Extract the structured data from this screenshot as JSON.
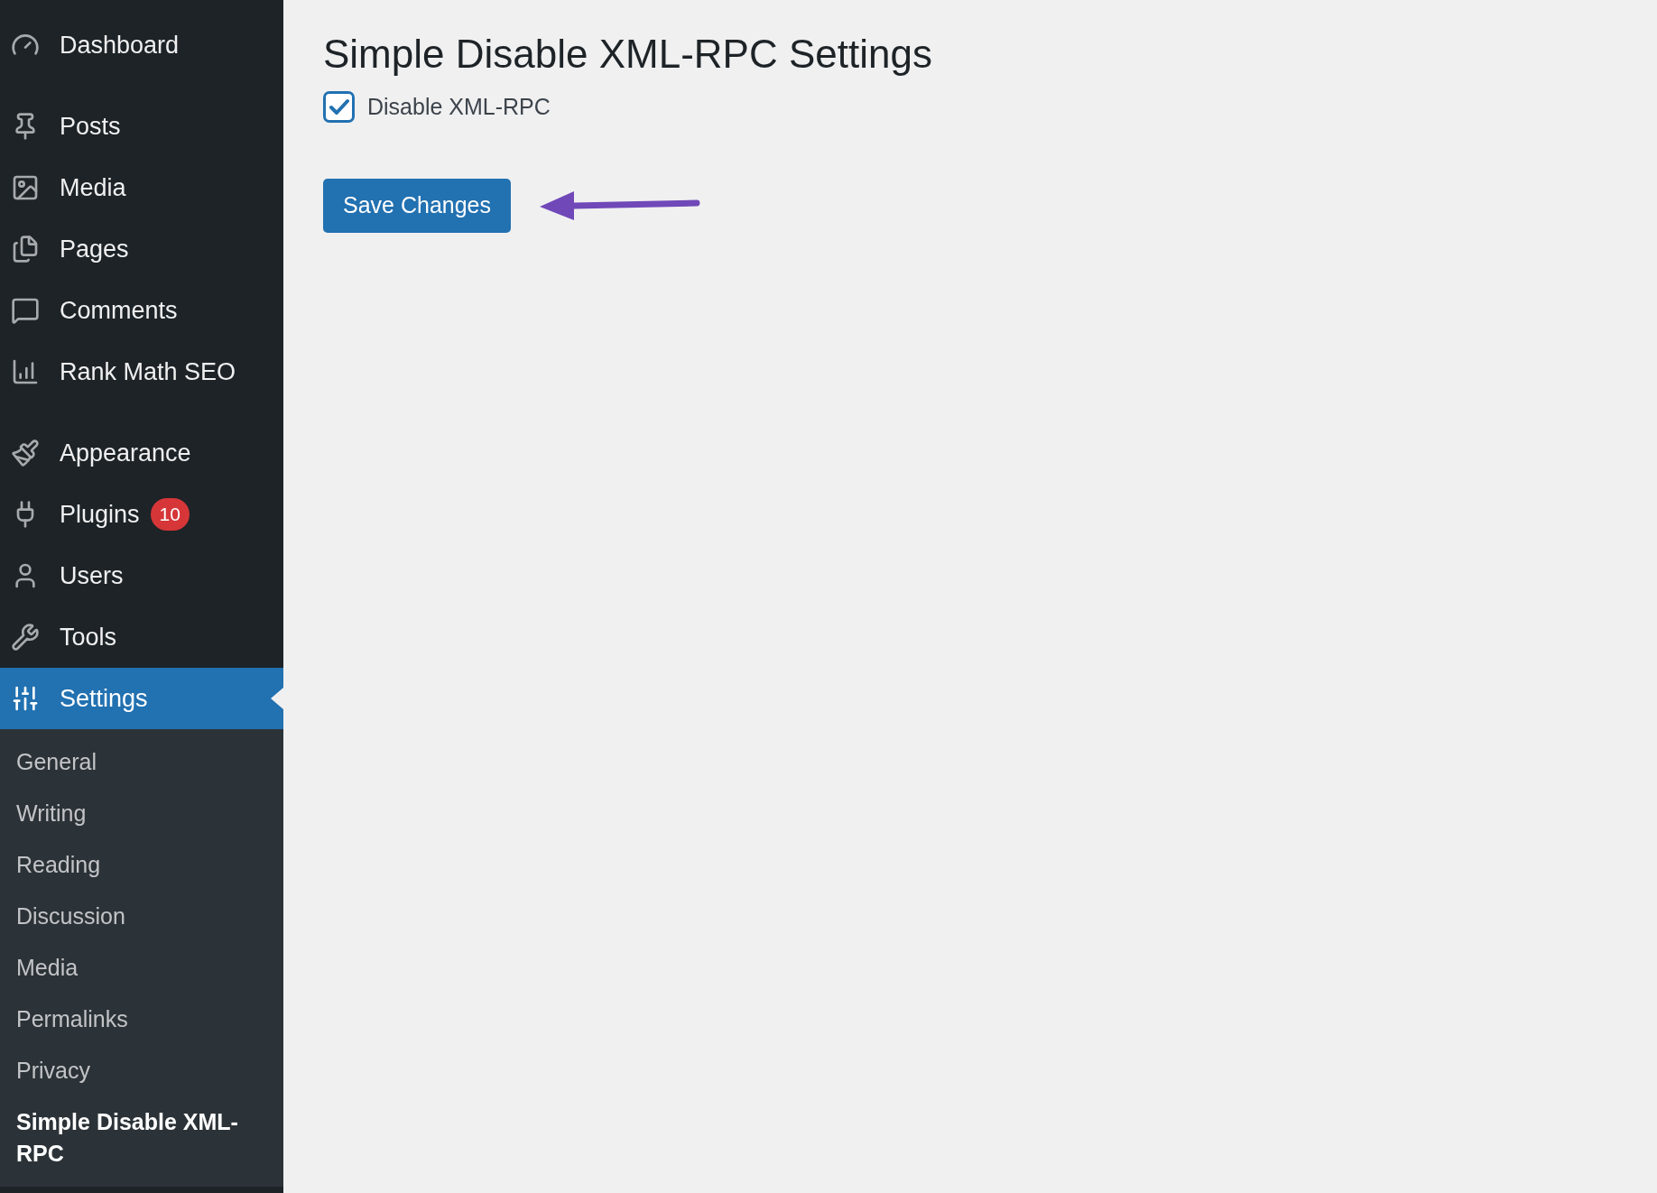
{
  "sidebar": {
    "menu_groups": [
      [
        {
          "label": "Dashboard",
          "selected": false
        }
      ],
      [
        {
          "label": "Posts",
          "selected": false
        },
        {
          "label": "Media",
          "selected": false
        },
        {
          "label": "Pages",
          "selected": false
        },
        {
          "label": "Comments",
          "selected": false
        },
        {
          "label": "Rank Math SEO",
          "selected": false
        }
      ],
      [
        {
          "label": "Appearance",
          "selected": false
        },
        {
          "label": "Plugins",
          "selected": false,
          "badge": "10"
        },
        {
          "label": "Users",
          "selected": false
        },
        {
          "label": "Tools",
          "selected": false
        },
        {
          "label": "Settings",
          "selected": true,
          "children": [
            {
              "label": "General",
              "selected": false
            },
            {
              "label": "Writing",
              "selected": false
            },
            {
              "label": "Reading",
              "selected": false
            },
            {
              "label": "Discussion",
              "selected": false
            },
            {
              "label": "Media",
              "selected": false
            },
            {
              "label": "Permalinks",
              "selected": false
            },
            {
              "label": "Privacy",
              "selected": false
            },
            {
              "label": "Simple Disable XML-RPC",
              "selected": true
            }
          ]
        }
      ]
    ]
  },
  "main": {
    "title": "Simple Disable XML-RPC Settings",
    "option": {
      "label": "Disable XML-RPC",
      "checked": true
    },
    "save_button": "Save Changes"
  }
}
